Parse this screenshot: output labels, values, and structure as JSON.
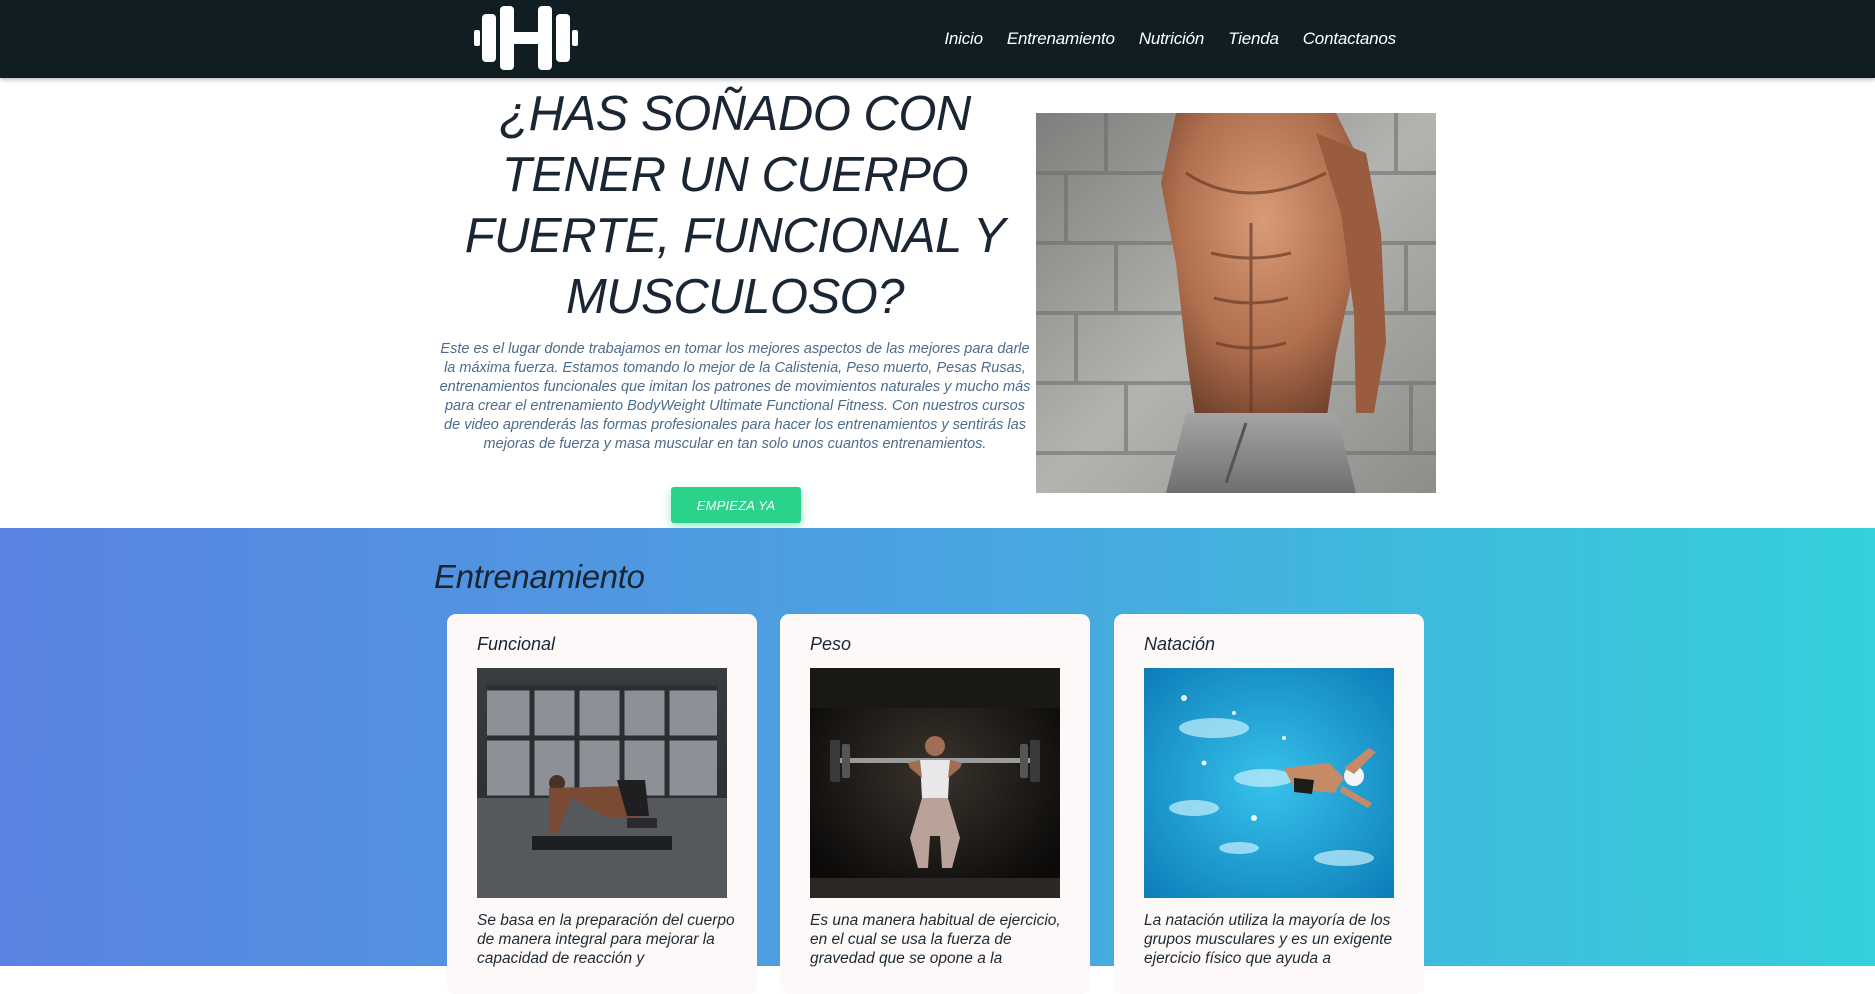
{
  "header": {
    "logo_icon": "dumbbell-h-logo",
    "nav": [
      {
        "label": "Inicio"
      },
      {
        "label": "Entrenamiento"
      },
      {
        "label": "Nutrición"
      },
      {
        "label": "Tienda"
      },
      {
        "label": "Contactanos"
      }
    ]
  },
  "hero": {
    "title": "¿Has soñado con tener un cuerpo fuerte, funcional y musculoso?",
    "text": "Este es el lugar donde trabajamos en tomar los mejores aspectos de las mejores para darle la máxima fuerza. Estamos tomando lo mejor de la Calistenia, Peso muerto, Pesas Rusas, entrenamientos funcionales que imitan los patrones de movimientos naturales y mucho más para crear el entrenamiento BodyWeight Ultimate Functional Fitness. Con nuestros cursos de video aprenderás las formas profesionales para hacer los entrenamientos y sentirás las mejoras de fuerza y masa muscular en tan solo unos cuantos entrenamientos.",
    "cta_label": "Empieza ya",
    "photo": "muscular-torso-photo"
  },
  "training": {
    "title": "Entrenamiento",
    "cards": [
      {
        "title": "Funcional",
        "photo": "functional-training-photo",
        "text": "Se basa en la preparación del cuerpo de manera integral para mejorar la capacidad de reacción y"
      },
      {
        "title": "Peso",
        "photo": "weightlifting-photo",
        "text": "Es una manera habitual de ejercicio, en el cual se usa la fuerza de gravedad que se opone a la"
      },
      {
        "title": "Natación",
        "photo": "swimming-photo",
        "text": "La natación utiliza la mayoría de los grupos musculares y es un exigente ejercicio físico que ayuda a"
      }
    ]
  },
  "colors": {
    "header_bg": "#101d23",
    "cta_green": "#2ad28a",
    "gradient_start": "#5a82e2",
    "gradient_end": "#34d0db",
    "card_bg": "#fcf9f8",
    "heading": "#1a2634"
  }
}
